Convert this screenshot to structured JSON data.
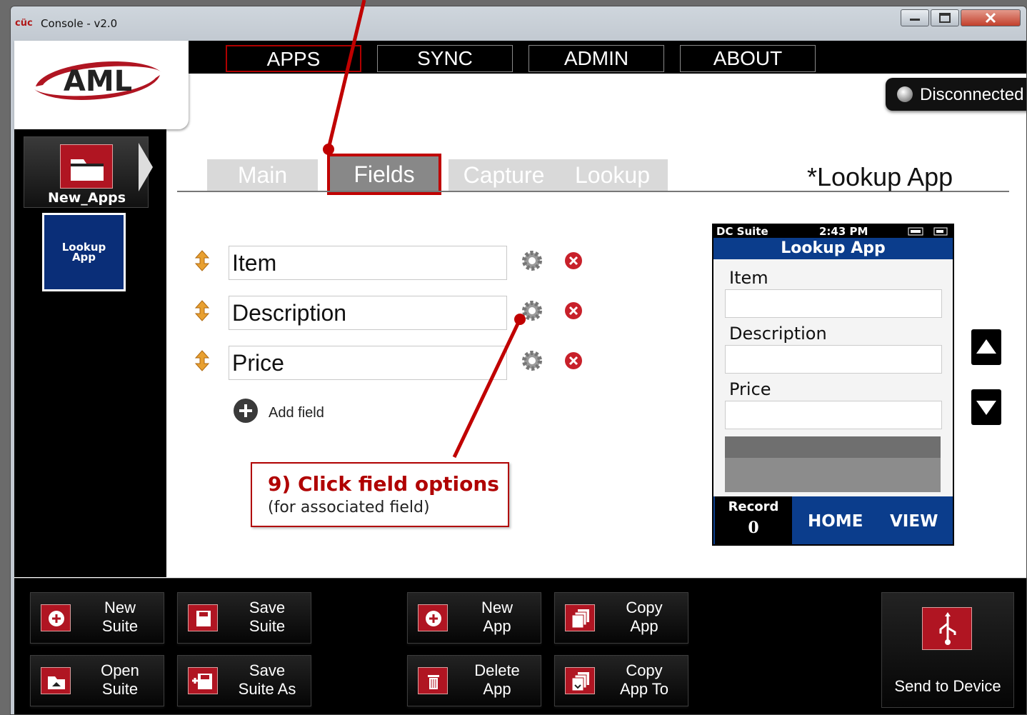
{
  "window": {
    "title": "Console - v2.0",
    "app_icon_text": "cüc"
  },
  "nav": {
    "tabs": [
      "APPS",
      "SYNC",
      "ADMIN",
      "ABOUT"
    ],
    "active": "APPS"
  },
  "logo": {
    "text": "AML"
  },
  "status": {
    "label": "Disconnected"
  },
  "sidebar": {
    "suite_name": "New_Apps",
    "app_tile": {
      "line1": "Lookup",
      "line2": "App"
    }
  },
  "subtabs": [
    "Main",
    "Fields",
    "Capture",
    "Lookup"
  ],
  "active_subtab": "Fields",
  "app_title": "*Lookup App",
  "fields": [
    {
      "name": "Item"
    },
    {
      "name": "Description"
    },
    {
      "name": "Price"
    }
  ],
  "add_field_label": "Add field",
  "callout": {
    "title": "9) Click field options",
    "subtitle": "(for associated field)"
  },
  "device": {
    "status_left": "DC Suite",
    "status_time": "2:43 PM",
    "header": "Lookup App",
    "labels": [
      "Item",
      "Description",
      "Price"
    ],
    "record_label": "Record",
    "record_value": "0",
    "home_label": "HOME",
    "view_label": "VIEW"
  },
  "toolbar": {
    "new_suite": "New\nSuite",
    "save_suite": "Save\nSuite",
    "open_suite": "Open\nSuite",
    "save_suite_as": "Save\nSuite As",
    "new_app": "New\nApp",
    "copy_app": "Copy\nApp",
    "delete_app": "Delete\nApp",
    "copy_app_to": "Copy\nApp To",
    "send_to_device": "Send to Device"
  },
  "colors": {
    "accent_red": "#b00000",
    "device_blue": "#0b3d8c",
    "app_tile_blue": "#0a2e78"
  }
}
